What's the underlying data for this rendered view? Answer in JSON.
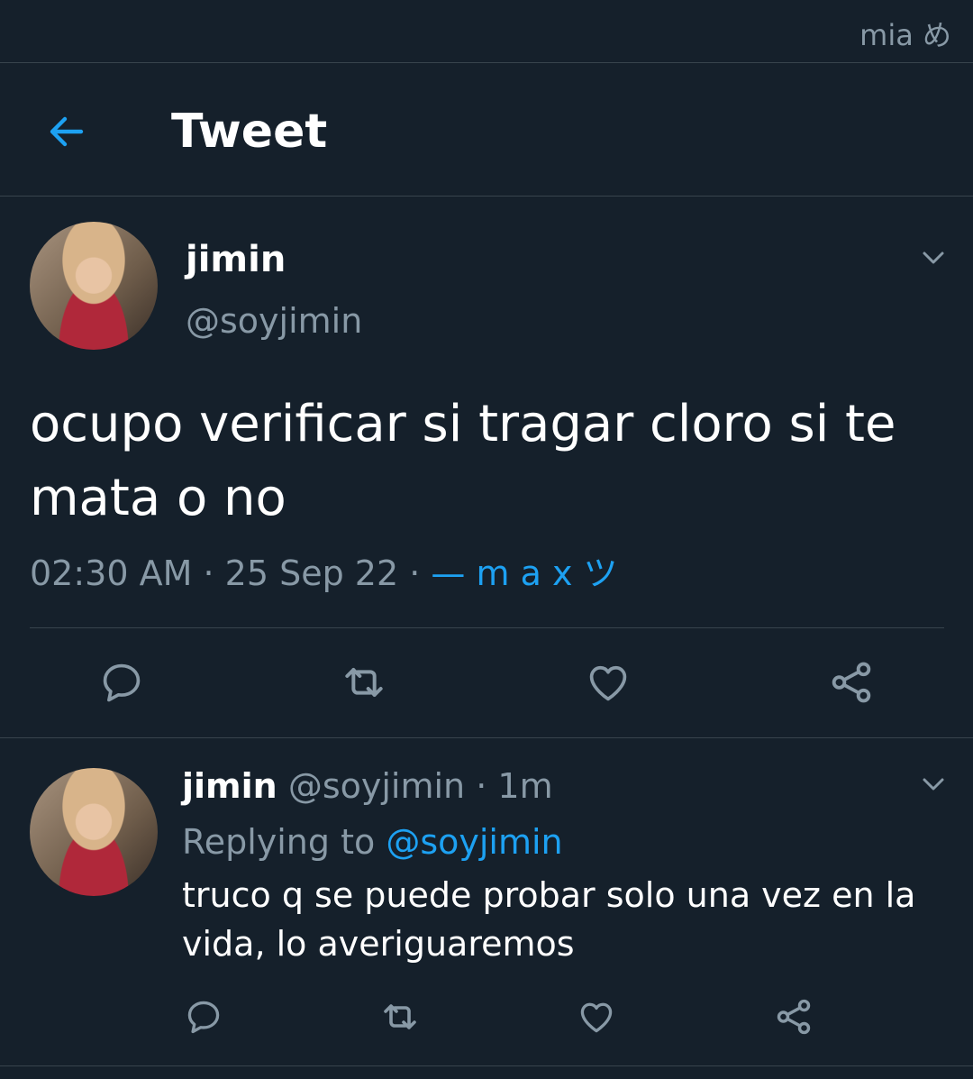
{
  "status_bar": {
    "text": "mia め"
  },
  "header": {
    "title": "Tweet"
  },
  "tweet": {
    "author_name": "jimin",
    "author_handle": "@soyjimin",
    "text": "ocupo verificar si tragar cloro si te mata o no",
    "time": "02:30 AM",
    "date": "25 Sep 22",
    "source": "— m a x ツ"
  },
  "reply": {
    "author_name": "jimin",
    "author_handle": "@soyjimin",
    "age": "1m",
    "replying_to_label": "Replying to",
    "replying_to_handle": "@soyjimin",
    "text": "truco q se puede probar solo una vez en la vida, lo averiguaremos"
  },
  "colors": {
    "background": "#15202b",
    "accent": "#1da1f2",
    "secondary_text": "#8899a6",
    "divider": "#38444d"
  },
  "icons": [
    "back-arrow-icon",
    "chevron-down-icon",
    "reply-icon",
    "retweet-icon",
    "like-icon",
    "share-icon"
  ]
}
